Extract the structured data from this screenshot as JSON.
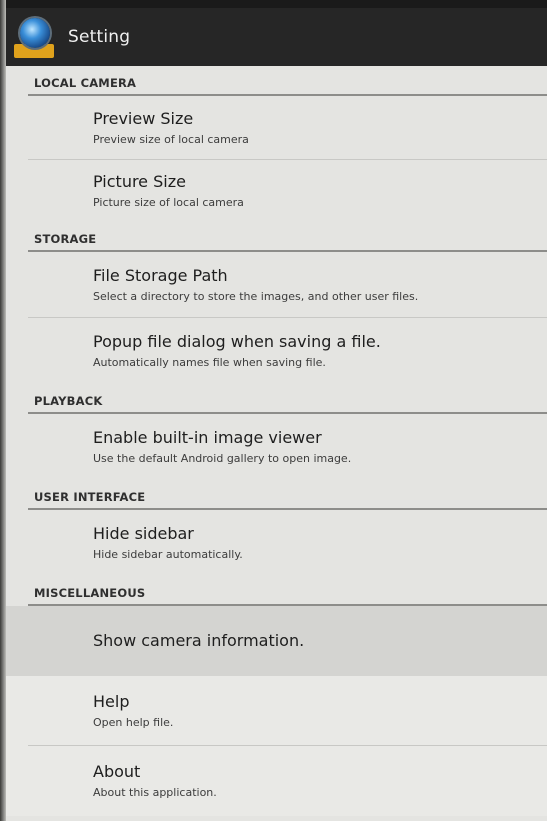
{
  "app_bar": {
    "title": "Setting",
    "icon": "camera-app-icon"
  },
  "sections": [
    {
      "header": "LOCAL CAMERA",
      "items": [
        {
          "title": "Preview Size",
          "summary": "Preview size of local camera"
        },
        {
          "title": "Picture Size",
          "summary": "Picture size of local camera"
        }
      ]
    },
    {
      "header": "STORAGE",
      "items": [
        {
          "title": "File Storage Path",
          "summary": "Select a directory to store the images, and other user files."
        },
        {
          "title": "Popup file dialog when saving a file.",
          "summary": "Automatically names file when saving file."
        }
      ]
    },
    {
      "header": "PLAYBACK",
      "items": [
        {
          "title": "Enable built-in image viewer",
          "summary": "Use the default Android gallery to open image."
        }
      ]
    },
    {
      "header": "USER INTERFACE",
      "items": [
        {
          "title": "Hide sidebar",
          "summary": "Hide sidebar automatically."
        }
      ]
    },
    {
      "header": "MISCELLANEOUS",
      "items": [
        {
          "title": "Show camera information."
        },
        {
          "title": "Help",
          "summary": "Open help file."
        },
        {
          "title": "About",
          "summary": "About this application."
        }
      ]
    }
  ]
}
